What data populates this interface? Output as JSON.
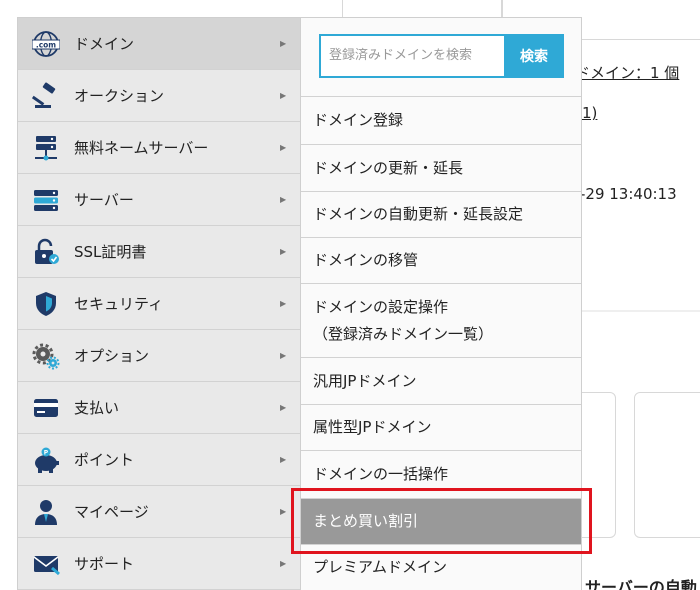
{
  "background": {
    "count_text": "ドメイン：1 個",
    "link_text": "1)",
    "datetime_text": "-29 13:40:13",
    "section_title": "サーバーの自動"
  },
  "left_menu": {
    "items": [
      {
        "label": "ドメイン",
        "icon": "dotcom-globe-icon"
      },
      {
        "label": "オークション",
        "icon": "gavel-icon"
      },
      {
        "label": "無料ネームサーバー",
        "icon": "name-server-icon"
      },
      {
        "label": "サーバー",
        "icon": "server-icon"
      },
      {
        "label": "SSL証明書",
        "icon": "ssl-lock-icon"
      },
      {
        "label": "セキュリティ",
        "icon": "shield-icon"
      },
      {
        "label": "オプション",
        "icon": "gears-icon"
      },
      {
        "label": "支払い",
        "icon": "credit-card-icon"
      },
      {
        "label": "ポイント",
        "icon": "piggy-bank-icon"
      },
      {
        "label": "マイページ",
        "icon": "user-icon"
      },
      {
        "label": "サポート",
        "icon": "mail-icon"
      }
    ],
    "arrow": "▶"
  },
  "submenu": {
    "search_placeholder": "登録済みドメインを検索",
    "search_button": "検索",
    "items": [
      {
        "label": "ドメイン登録"
      },
      {
        "label": "ドメインの更新・延長"
      },
      {
        "label": "ドメインの自動更新・延長設定"
      },
      {
        "label": "ドメインの移管"
      },
      {
        "label": "ドメインの設定操作",
        "label2": "（登録済みドメイン一覧）"
      },
      {
        "label": "汎用JPドメイン"
      },
      {
        "label": "属性型JPドメイン"
      },
      {
        "label": "ドメインの一括操作"
      },
      {
        "label": "まとめ買い割引"
      },
      {
        "label": "プレミアムドメイン"
      }
    ]
  },
  "colors": {
    "accent_blue": "#2fa9d6",
    "highlight_gray": "#999999",
    "red_frame": "#e0141e",
    "icon_navy": "#1f3a68"
  }
}
